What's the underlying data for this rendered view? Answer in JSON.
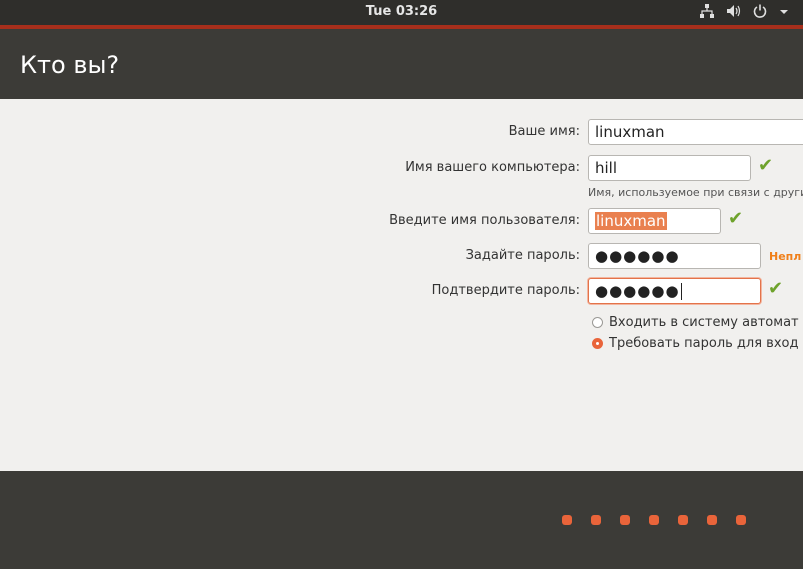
{
  "topbar": {
    "clock": "Tue 03:26",
    "icons": [
      "network-icon",
      "volume-icon",
      "power-icon",
      "chevron-down-icon"
    ]
  },
  "header": {
    "title": "Кто вы?"
  },
  "form": {
    "name_label": "Ваше имя:",
    "name_value": "linuxman",
    "computer_label": "Имя вашего компьютера:",
    "computer_value": "hill",
    "computer_hint": "Имя, используемое при связи с други",
    "username_label": "Введите имя пользователя:",
    "username_value": "linuxman",
    "password_label": "Задайте пароль:",
    "password_value": "●●●●●●",
    "password_warning": "Непл",
    "confirm_label": "Подтвердите пароль:",
    "confirm_value": "●●●●●●",
    "login_auto": "Входить в систему автомат",
    "login_password": "Требовать пароль для вход",
    "selected_login_option": "login_password"
  },
  "footer": {
    "progress_steps": 7
  },
  "colors": {
    "accent": "#e9643a",
    "ok": "#6ea22b",
    "warning": "#f07f19"
  }
}
